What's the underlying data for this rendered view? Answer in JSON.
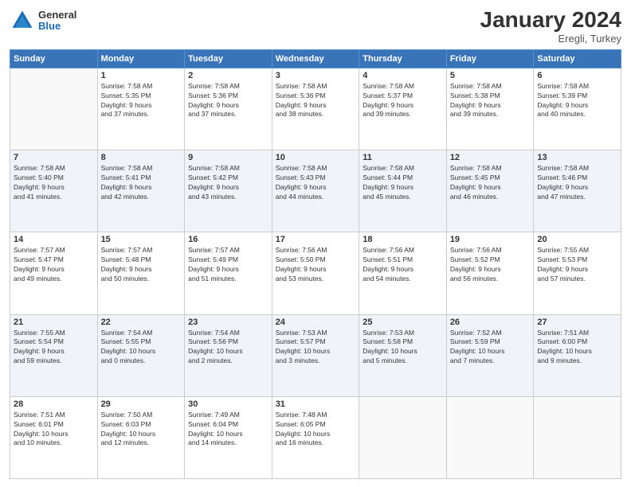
{
  "logo": {
    "general": "General",
    "blue": "Blue"
  },
  "title": "January 2024",
  "location": "Eregli, Turkey",
  "weekdays": [
    "Sunday",
    "Monday",
    "Tuesday",
    "Wednesday",
    "Thursday",
    "Friday",
    "Saturday"
  ],
  "weeks": [
    [
      {
        "day": "",
        "info": ""
      },
      {
        "day": "1",
        "info": "Sunrise: 7:58 AM\nSunset: 5:35 PM\nDaylight: 9 hours\nand 37 minutes."
      },
      {
        "day": "2",
        "info": "Sunrise: 7:58 AM\nSunset: 5:36 PM\nDaylight: 9 hours\nand 37 minutes."
      },
      {
        "day": "3",
        "info": "Sunrise: 7:58 AM\nSunset: 5:36 PM\nDaylight: 9 hours\nand 38 minutes."
      },
      {
        "day": "4",
        "info": "Sunrise: 7:58 AM\nSunset: 5:37 PM\nDaylight: 9 hours\nand 39 minutes."
      },
      {
        "day": "5",
        "info": "Sunrise: 7:58 AM\nSunset: 5:38 PM\nDaylight: 9 hours\nand 39 minutes."
      },
      {
        "day": "6",
        "info": "Sunrise: 7:58 AM\nSunset: 5:39 PM\nDaylight: 9 hours\nand 40 minutes."
      }
    ],
    [
      {
        "day": "7",
        "info": "Sunrise: 7:58 AM\nSunset: 5:40 PM\nDaylight: 9 hours\nand 41 minutes."
      },
      {
        "day": "8",
        "info": "Sunrise: 7:58 AM\nSunset: 5:41 PM\nDaylight: 9 hours\nand 42 minutes."
      },
      {
        "day": "9",
        "info": "Sunrise: 7:58 AM\nSunset: 5:42 PM\nDaylight: 9 hours\nand 43 minutes."
      },
      {
        "day": "10",
        "info": "Sunrise: 7:58 AM\nSunset: 5:43 PM\nDaylight: 9 hours\nand 44 minutes."
      },
      {
        "day": "11",
        "info": "Sunrise: 7:58 AM\nSunset: 5:44 PM\nDaylight: 9 hours\nand 45 minutes."
      },
      {
        "day": "12",
        "info": "Sunrise: 7:58 AM\nSunset: 5:45 PM\nDaylight: 9 hours\nand 46 minutes."
      },
      {
        "day": "13",
        "info": "Sunrise: 7:58 AM\nSunset: 5:46 PM\nDaylight: 9 hours\nand 47 minutes."
      }
    ],
    [
      {
        "day": "14",
        "info": "Sunrise: 7:57 AM\nSunset: 5:47 PM\nDaylight: 9 hours\nand 49 minutes."
      },
      {
        "day": "15",
        "info": "Sunrise: 7:57 AM\nSunset: 5:48 PM\nDaylight: 9 hours\nand 50 minutes."
      },
      {
        "day": "16",
        "info": "Sunrise: 7:57 AM\nSunset: 5:49 PM\nDaylight: 9 hours\nand 51 minutes."
      },
      {
        "day": "17",
        "info": "Sunrise: 7:56 AM\nSunset: 5:50 PM\nDaylight: 9 hours\nand 53 minutes."
      },
      {
        "day": "18",
        "info": "Sunrise: 7:56 AM\nSunset: 5:51 PM\nDaylight: 9 hours\nand 54 minutes."
      },
      {
        "day": "19",
        "info": "Sunrise: 7:56 AM\nSunset: 5:52 PM\nDaylight: 9 hours\nand 56 minutes."
      },
      {
        "day": "20",
        "info": "Sunrise: 7:55 AM\nSunset: 5:53 PM\nDaylight: 9 hours\nand 57 minutes."
      }
    ],
    [
      {
        "day": "21",
        "info": "Sunrise: 7:55 AM\nSunset: 5:54 PM\nDaylight: 9 hours\nand 59 minutes."
      },
      {
        "day": "22",
        "info": "Sunrise: 7:54 AM\nSunset: 5:55 PM\nDaylight: 10 hours\nand 0 minutes."
      },
      {
        "day": "23",
        "info": "Sunrise: 7:54 AM\nSunset: 5:56 PM\nDaylight: 10 hours\nand 2 minutes."
      },
      {
        "day": "24",
        "info": "Sunrise: 7:53 AM\nSunset: 5:57 PM\nDaylight: 10 hours\nand 3 minutes."
      },
      {
        "day": "25",
        "info": "Sunrise: 7:53 AM\nSunset: 5:58 PM\nDaylight: 10 hours\nand 5 minutes."
      },
      {
        "day": "26",
        "info": "Sunrise: 7:52 AM\nSunset: 5:59 PM\nDaylight: 10 hours\nand 7 minutes."
      },
      {
        "day": "27",
        "info": "Sunrise: 7:51 AM\nSunset: 6:00 PM\nDaylight: 10 hours\nand 9 minutes."
      }
    ],
    [
      {
        "day": "28",
        "info": "Sunrise: 7:51 AM\nSunset: 6:01 PM\nDaylight: 10 hours\nand 10 minutes."
      },
      {
        "day": "29",
        "info": "Sunrise: 7:50 AM\nSunset: 6:03 PM\nDaylight: 10 hours\nand 12 minutes."
      },
      {
        "day": "30",
        "info": "Sunrise: 7:49 AM\nSunset: 6:04 PM\nDaylight: 10 hours\nand 14 minutes."
      },
      {
        "day": "31",
        "info": "Sunrise: 7:48 AM\nSunset: 6:05 PM\nDaylight: 10 hours\nand 16 minutes."
      },
      {
        "day": "",
        "info": ""
      },
      {
        "day": "",
        "info": ""
      },
      {
        "day": "",
        "info": ""
      }
    ]
  ]
}
